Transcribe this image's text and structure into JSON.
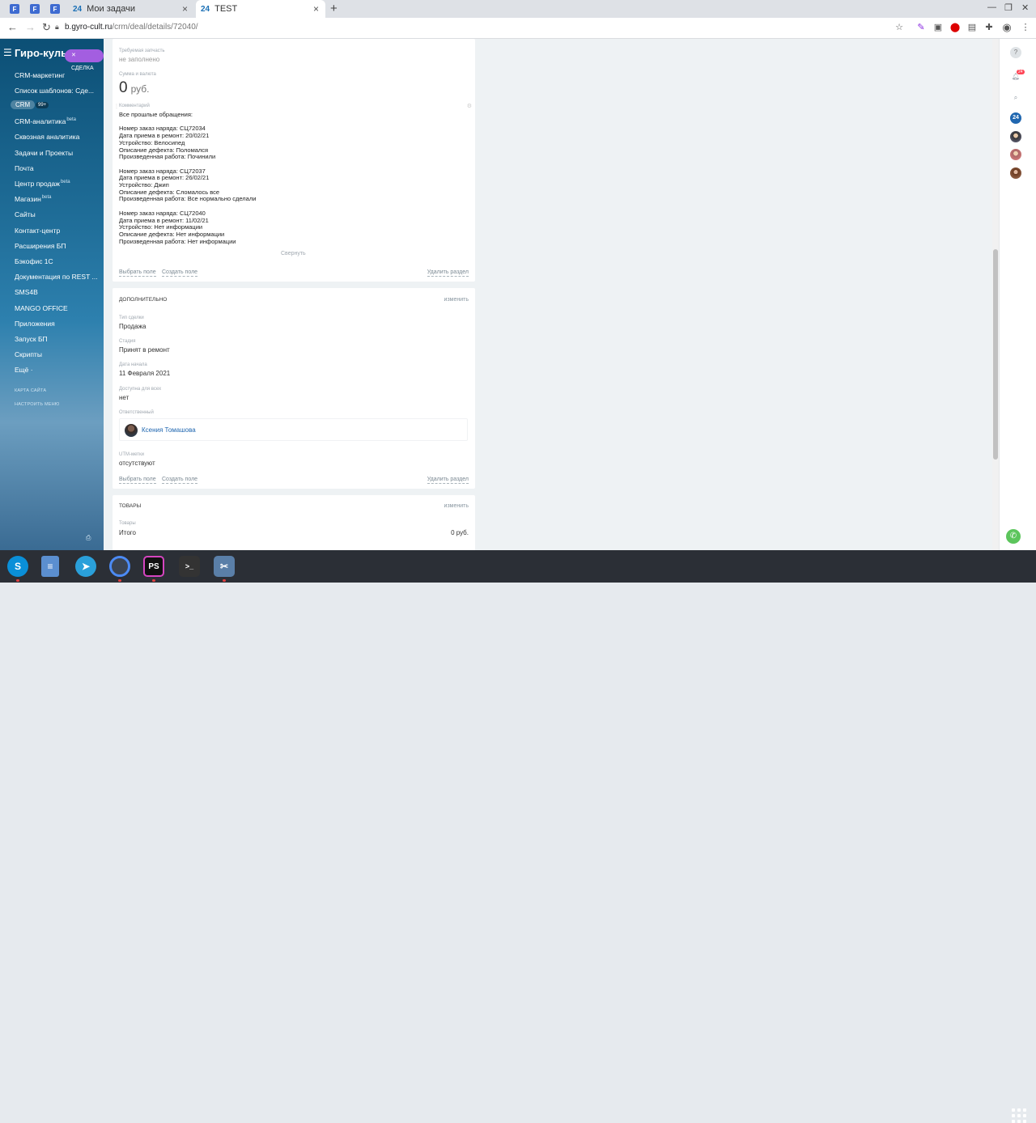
{
  "browser": {
    "pinned_tabs": [
      "F",
      "F",
      "F"
    ],
    "tabs": [
      {
        "badge": "24",
        "title": "Мои задачи",
        "close": "×"
      },
      {
        "badge": "24",
        "title": "TEST",
        "close": "×"
      }
    ],
    "new_tab": "+",
    "url_host": "b.gyro-cult.ru",
    "url_path": "/crm/deal/details/72040/"
  },
  "sidebar": {
    "title": "Гиро-куль",
    "deal_chip": "СДЕЛКА",
    "crm_label": "CRM",
    "crm_badge": "99+",
    "items": [
      {
        "label": "CRM-маркетинг"
      },
      {
        "label": "Список шаблонов: Сде..."
      },
      {
        "label": "CRM-аналитика",
        "sup": "beta"
      },
      {
        "label": "Сквозная аналитика"
      },
      {
        "label": "Задачи и Проекты"
      },
      {
        "label": "Почта"
      },
      {
        "label": "Центр продаж",
        "sup": "beta"
      },
      {
        "label": "Магазин",
        "sup": "beta"
      },
      {
        "label": "Сайты"
      },
      {
        "label": "Контакт-центр"
      },
      {
        "label": "Расширения БП"
      },
      {
        "label": "Бэкофис 1С"
      },
      {
        "label": "Документация по REST ..."
      },
      {
        "label": "SMS4B"
      },
      {
        "label": "MANGO OFFICE"
      },
      {
        "label": "Приложения"
      },
      {
        "label": "Запуск БП"
      },
      {
        "label": "Скрипты"
      },
      {
        "label": "Ещё ·"
      }
    ],
    "sitemap": "Карта сайта",
    "configure": "Настроить меню"
  },
  "main": {
    "parts_label": "Требуемая запчасть",
    "parts_value": "не заполнено",
    "sum_label": "Сумма и валюта",
    "sum_value": "0",
    "sum_currency": "руб.",
    "comment_label": "Комментарий",
    "comment_lines": [
      "Все прошлые обращения:",
      "",
      "Номер заказ наряда: СЦ72034",
      "Дата приема в ремонт: 20/02/21",
      "Устройство: Велосипед",
      "Описание дефекта: Поломался",
      "Произведенная работа: Починили",
      "",
      "Номер заказ наряда: СЦ72037",
      "Дата приема в ремонт: 26/02/21",
      "Устройство: Джип",
      "Описание дефекта: Сломалось все",
      "Произведенная работа: Все нормально сделали",
      "",
      "Номер заказ наряда: СЦ72040",
      "Дата приема в ремонт: 11/02/21",
      "Устройство: Нет информации",
      "Описание дефекта: Нет информации",
      "Произведенная работа: Нет информации"
    ],
    "collapse": "Свернуть",
    "select_field": "Выбрать поле",
    "create_field": "Создать поле",
    "delete_section": "Удалить раздел",
    "extra": {
      "title": "Дополнительно",
      "edit": "изменить",
      "deal_type_label": "Тип сделки",
      "deal_type": "Продажа",
      "stage_label": "Стадия",
      "stage": "Принят в ремонт",
      "start_label": "Дата начала",
      "start": "11 Февраля 2021",
      "public_label": "Доступна для всех",
      "public": "нет",
      "resp_label": "Ответственный",
      "resp": "Ксения Томашова",
      "utm_label": "UTM-метки",
      "utm": "отсутствуют"
    },
    "goods": {
      "title": "Товары",
      "edit": "изменить",
      "goods_label": "Товары",
      "total_label": "Итого",
      "total": "0 руб."
    }
  },
  "right_panel": {
    "notif_count": "24",
    "b24": "24"
  },
  "taskbar": [
    "S",
    "",
    "",
    "",
    "PS",
    ">_",
    ""
  ]
}
